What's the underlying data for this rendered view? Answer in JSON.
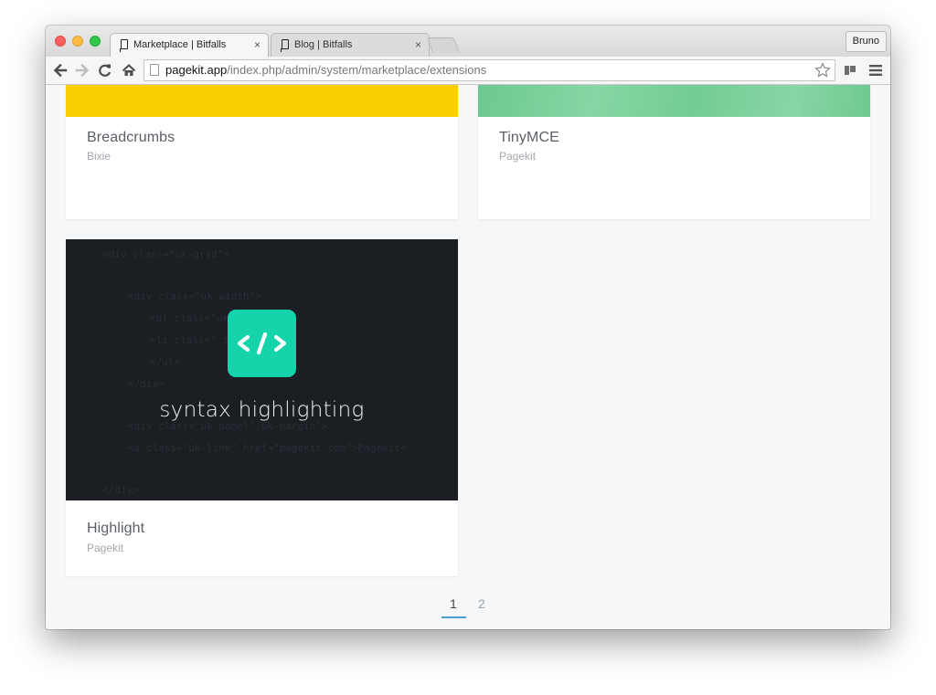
{
  "browser": {
    "tabs": [
      {
        "title": "Marketplace | Bitfalls",
        "close": "×"
      },
      {
        "title": "Blog | Bitfalls",
        "close": "×"
      }
    ],
    "profile_name": "Bruno",
    "url_host": "pagekit.app",
    "url_path": "/index.php/admin/system/marketplace/extensions"
  },
  "extensions": [
    {
      "title": "Breadcrumbs",
      "author": "Bixie",
      "thumb_color": "#fbcf00"
    },
    {
      "title": "TinyMCE",
      "author": "Pagekit",
      "thumb_color": "#75cd96"
    },
    {
      "title": "Highlight",
      "author": "Pagekit",
      "thumb_text": "syntax highlighting",
      "tile_color": "#15d3ab"
    }
  ],
  "pagination": {
    "pages": [
      "1",
      "2"
    ],
    "current": "1",
    "accent": "#4a9fcf"
  }
}
